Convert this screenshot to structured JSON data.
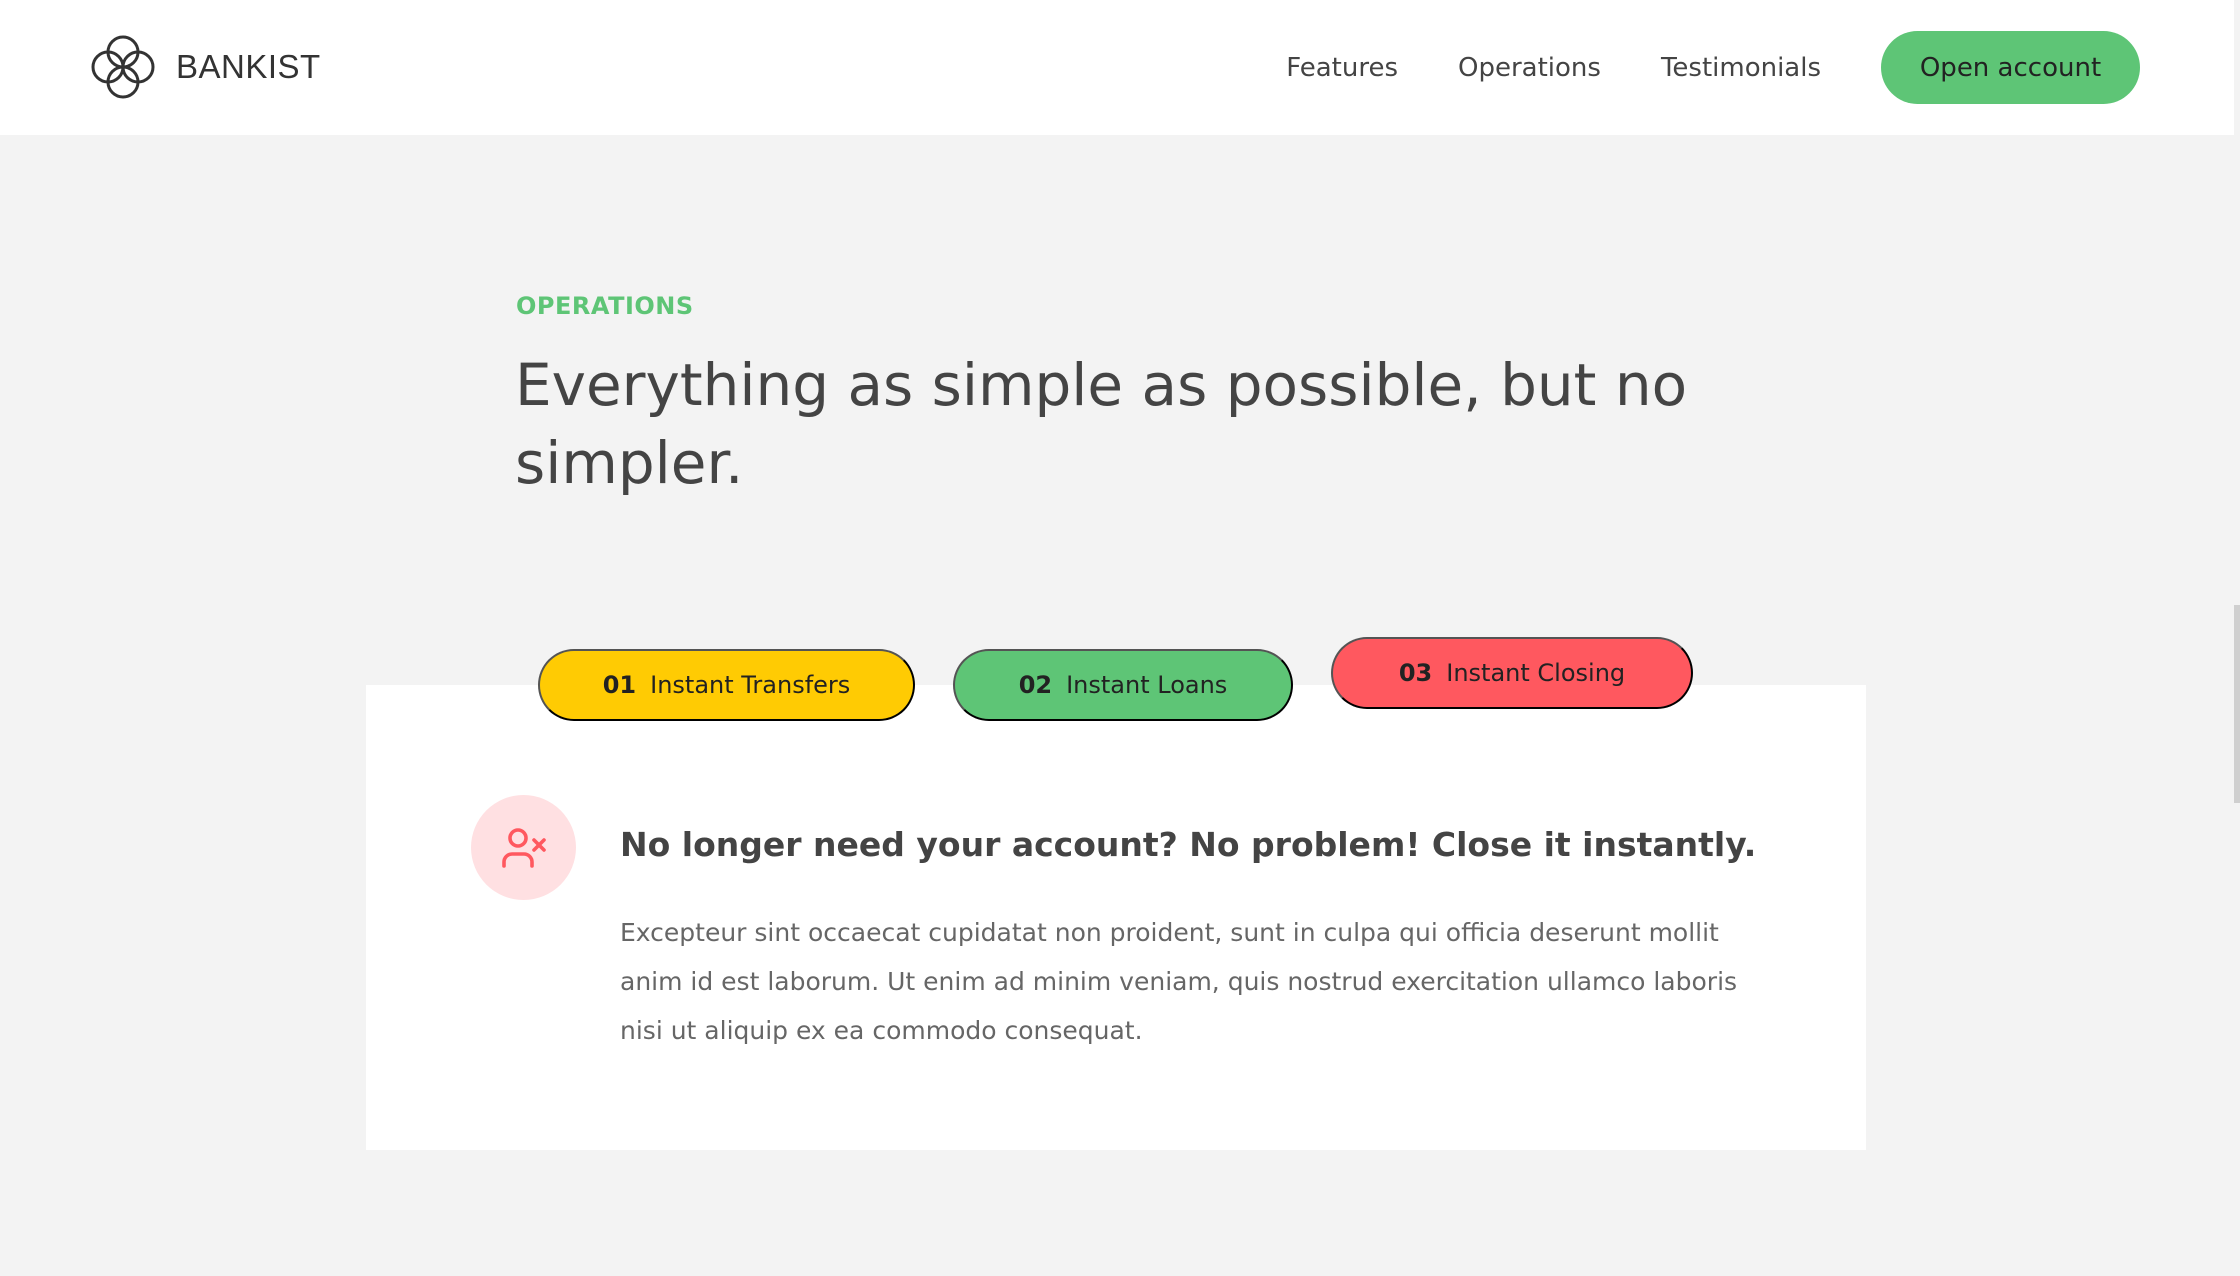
{
  "nav": {
    "logo_text": "BANKIST",
    "logo_icon": "bankist-logo-icon",
    "links": [
      "Features",
      "Operations",
      "Testimonials"
    ],
    "cta_label": "Open account"
  },
  "section": {
    "kicker": "OPERATIONS",
    "heading": "Everything as simple as possible, but no simpler."
  },
  "operations": {
    "tabs": [
      {
        "number": "01",
        "label": "Instant Transfers",
        "color": "#ffcb03"
      },
      {
        "number": "02",
        "label": "Instant Loans",
        "color": "#5ec576"
      },
      {
        "number": "03",
        "label": "Instant Closing",
        "color": "#ff585f"
      }
    ],
    "active_tab": 2,
    "content": {
      "icon": "user-x-icon",
      "icon_color": "#ff585f",
      "icon_bg": "#ffe0e2",
      "title": "No longer need your account? No problem! Close it instantly.",
      "text": "Excepteur sint occaecat cupidatat non proident, sunt in culpa qui officia deserunt mollit anim id est laborum. Ut enim ad minim veniam, quis nostrud exercitation ullamco laboris nisi ut aliquip ex ea commodo consequat."
    }
  },
  "colors": {
    "accent_green": "#5ec576",
    "accent_yellow": "#ffcb03",
    "accent_red": "#ff585f",
    "background": "#f3f3f3"
  }
}
